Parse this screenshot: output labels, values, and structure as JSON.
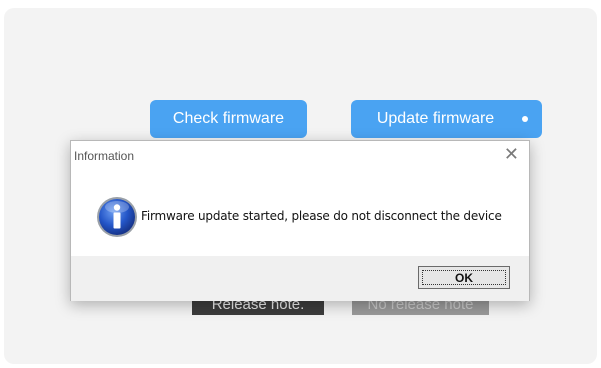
{
  "app": {
    "check_firmware_label": "Check firmware",
    "update_firmware_label": "Update firmware",
    "release_note_label": "Release note.",
    "no_release_note_label": "No release note"
  },
  "dialog": {
    "title": "Information",
    "close_glyph": "✕",
    "message": "Firmware update started, please do not disconnect the device",
    "ok_label": "OK",
    "icon": "info-icon"
  },
  "colors": {
    "accent": "#4aa3f2",
    "icon_blue": "#1f4fc2"
  }
}
